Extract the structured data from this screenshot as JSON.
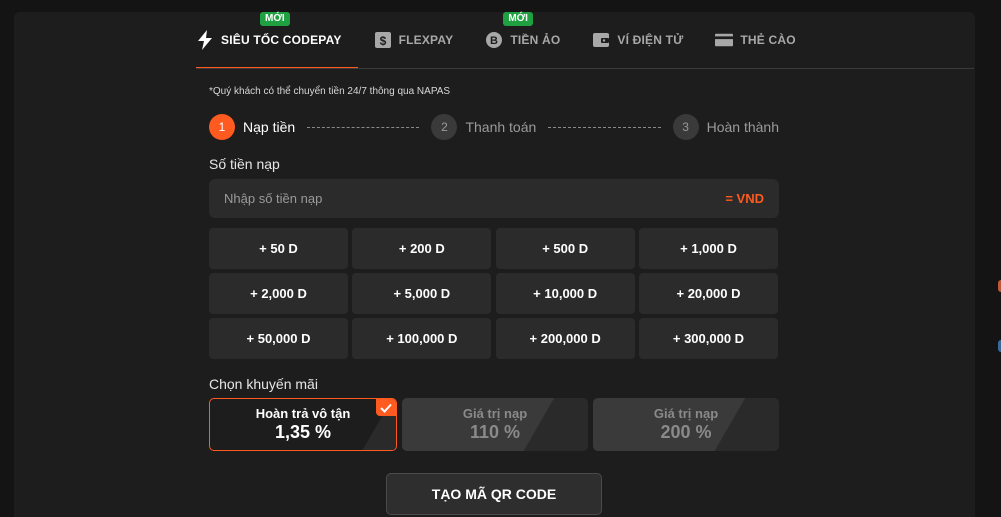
{
  "tabs": [
    {
      "label": "SIÊU TỐC CODEPAY",
      "icon": "lightning-icon",
      "badge": "MỚI",
      "active": true
    },
    {
      "label": "FLEXPAY",
      "icon": "dollar-note-icon",
      "badge": null,
      "active": false
    },
    {
      "label": "TIỀN ẢO",
      "icon": "bitcoin-icon",
      "badge": "MỚI",
      "active": false
    },
    {
      "label": "VÍ ĐIỆN TỬ",
      "icon": "wallet-icon",
      "badge": null,
      "active": false
    },
    {
      "label": "THẺ CÀO",
      "icon": "card-icon",
      "badge": null,
      "active": false
    }
  ],
  "note": "*Quý khách có thể chuyển tiền 24/7 thông qua NAPAS",
  "stepper": [
    {
      "number": "1",
      "label": "Nạp tiền",
      "active": true
    },
    {
      "number": "2",
      "label": "Thanh toán",
      "active": false
    },
    {
      "number": "3",
      "label": "Hoàn thành",
      "active": false
    }
  ],
  "amount": {
    "title": "Số tiền nạp",
    "placeholder": "Nhập số tiền nạp",
    "value": "",
    "unit": "= VND"
  },
  "quick_amounts": [
    "+ 50 D",
    "+ 200 D",
    "+ 500 D",
    "+ 1,000 D",
    "+ 2,000 D",
    "+ 5,000 D",
    "+ 10,000 D",
    "+ 20,000 D",
    "+ 50,000 D",
    "+ 100,000 D",
    "+ 200,000 D",
    "+ 300,000 D"
  ],
  "promo": {
    "title": "Chọn khuyến mãi",
    "options": [
      {
        "title": "Hoàn trả vô tận",
        "value": "1,35 %",
        "selected": true
      },
      {
        "title": "Giá trị nạp",
        "value": "110 %",
        "selected": false
      },
      {
        "title": "Giá trị nạp",
        "value": "200 %",
        "selected": false
      }
    ]
  },
  "submit_label": "TẠO MÃ QR CODE",
  "colors": {
    "accent": "#ff5a1f",
    "badge_green": "#1fa141",
    "background": "#1d1d1d"
  }
}
